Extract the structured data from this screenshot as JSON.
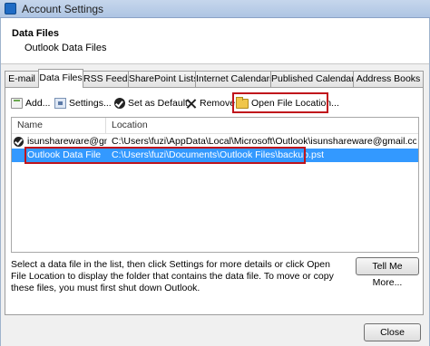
{
  "window": {
    "title": "Account Settings"
  },
  "header": {
    "title": "Data Files",
    "subtitle": "Outlook Data Files"
  },
  "tabs": [
    {
      "label": "E-mail"
    },
    {
      "label": "Data Files"
    },
    {
      "label": "RSS Feeds"
    },
    {
      "label": "SharePoint Lists"
    },
    {
      "label": "Internet Calendars"
    },
    {
      "label": "Published Calendars"
    },
    {
      "label": "Address Books"
    }
  ],
  "toolbar": {
    "add": "Add...",
    "settings": "Settings...",
    "set_default": "Set as Default",
    "remove": "Remove",
    "open_file_location": "Open File Location..."
  },
  "list": {
    "columns": [
      "Name",
      "Location"
    ],
    "rows": [
      {
        "name": "isunshareware@gm...",
        "location": "C:\\Users\\fuzi\\AppData\\Local\\Microsoft\\Outlook\\isunshareware@gmail.com.ost",
        "default": true
      },
      {
        "name": "Outlook Data File",
        "location": "C:\\Users\\fuzi\\Documents\\Outlook Files\\backup.pst",
        "selected": true
      }
    ]
  },
  "description": "Select a data file in the list, then click Settings for more details or click Open File Location to display the folder that contains the data file. To move or copy these files, you must first shut down Outlook.",
  "buttons": {
    "tell_me_more": "Tell Me More...",
    "close": "Close"
  },
  "colors": {
    "highlight": "#c0141b",
    "selection": "#3399ff"
  }
}
